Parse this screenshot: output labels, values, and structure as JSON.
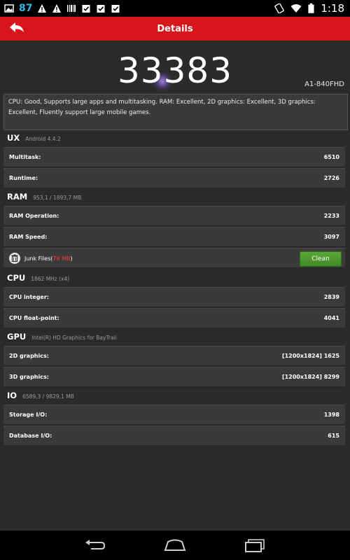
{
  "status_bar": {
    "notification_count": "87",
    "time": "1:18",
    "icons": [
      "warning-icon",
      "warning-icon",
      "barcode-icon",
      "clipboard-check-icon",
      "clipboard-check-icon",
      "clipboard-check-icon",
      "rotation-icon",
      "wifi-icon",
      "battery-icon"
    ]
  },
  "header": {
    "title": "Details",
    "back_icon": "back-arrow-icon",
    "color": "#d7161b"
  },
  "score": {
    "value": "33383",
    "device": "A1-840FHD"
  },
  "description": "CPU: Good, Supports large apps and multitasking. RAM: Excellent, 2D graphics: Excellent, 3D graphics: Excellent, Fluently support large mobile games.",
  "sections": {
    "ux": {
      "name": "UX",
      "sub": "Android 4.4.2",
      "rows": [
        {
          "label": "Multitask:",
          "value": "6510"
        },
        {
          "label": "Runtime:",
          "value": "2726"
        }
      ]
    },
    "ram": {
      "name": "RAM",
      "sub": "953,1 / 1893,7 MB",
      "rows": [
        {
          "label": "RAM Operation:",
          "value": "2233"
        },
        {
          "label": "RAM Speed:",
          "value": "3097"
        }
      ],
      "junk": {
        "label": "Junk Files",
        "size": "78 MB",
        "button": "Clean"
      }
    },
    "cpu": {
      "name": "CPU",
      "sub": "1862 MHz (x4)",
      "rows": [
        {
          "label": "CPU integer:",
          "value": "2839"
        },
        {
          "label": "CPU float-point:",
          "value": "4041"
        }
      ]
    },
    "gpu": {
      "name": "GPU",
      "sub": "Intel(R) HD Graphics for BayTrail",
      "rows": [
        {
          "label": "2D graphics:",
          "value": "[1200x1824] 1625"
        },
        {
          "label": "3D graphics:",
          "value": "[1200x1824] 8299"
        }
      ]
    },
    "io": {
      "name": "IO",
      "sub": "6589,3 / 9829,1 MB",
      "rows": [
        {
          "label": "Storage I/O:",
          "value": "1398"
        },
        {
          "label": "Database I/O:",
          "value": "615"
        }
      ]
    }
  },
  "nav": {
    "icons": [
      "back-nav-icon",
      "home-nav-icon",
      "recents-nav-icon"
    ]
  }
}
